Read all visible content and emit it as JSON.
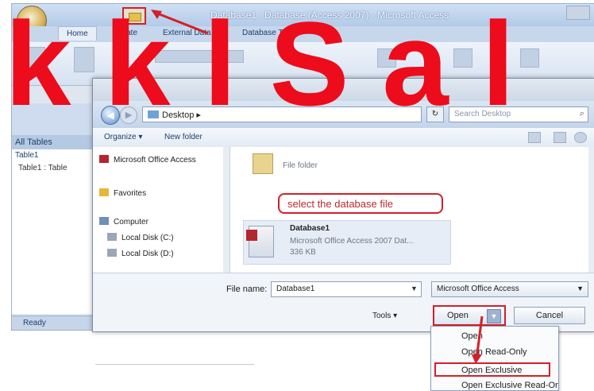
{
  "app": {
    "title": "Database1 : Database (Access 2007) - Microsoft Access",
    "tabs": [
      "Home",
      "Create",
      "External Data",
      "Database Tools"
    ],
    "nav_header": "All Tables",
    "nav_group": "Table1",
    "nav_item": "Table1 : Table",
    "status": "Ready"
  },
  "dialog": {
    "address": "Desktop",
    "address_sep": "▸",
    "search_placeholder": "Search Desktop",
    "organize": "Organize ▾",
    "new_folder": "New folder",
    "nav_items": [
      "Microsoft Office Access",
      "Favorites",
      "Computer",
      "Local Disk (C:)",
      "Local Disk (D:)"
    ],
    "folder_label": "File folder",
    "callout": "select the database file",
    "file": {
      "name": "Database1",
      "type": "Microsoft Office Access 2007 Dat...",
      "size": "336 KB"
    },
    "file_name_label": "File name:",
    "file_name_value": "Database1",
    "file_type": "Microsoft Office Access",
    "tools": "Tools",
    "open": "Open",
    "cancel": "Cancel"
  },
  "menu": {
    "items": [
      "Open",
      "Open Read-Only",
      "Open Exclusive",
      "Open Exclusive Read-Only"
    ]
  },
  "watermark": "k k l S a l",
  "colors": {
    "highlight_red": "#d3202a",
    "watermark_red": "#ec0c1c"
  }
}
